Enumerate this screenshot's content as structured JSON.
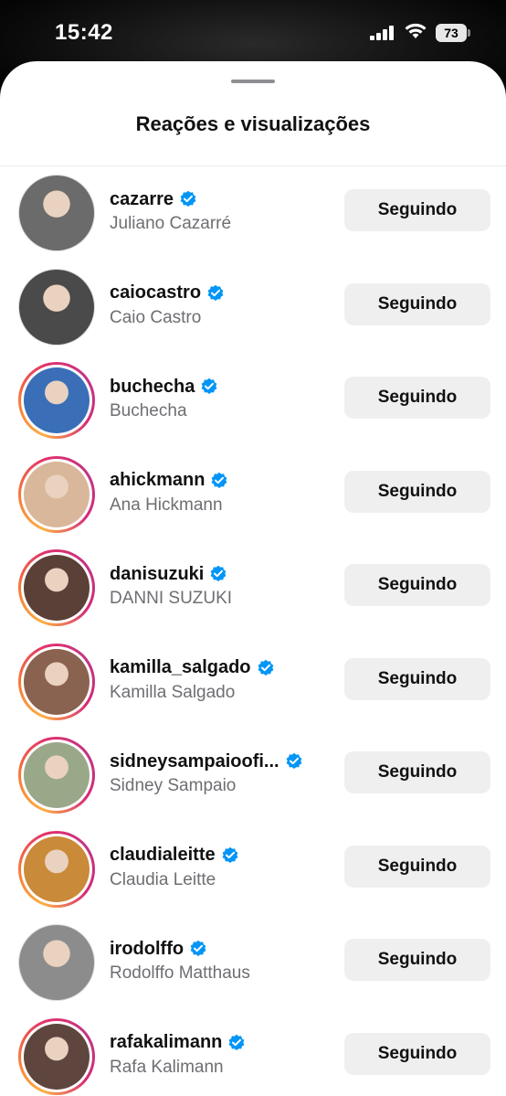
{
  "status_bar": {
    "time": "15:42",
    "battery": "73"
  },
  "sheet": {
    "title": "Reações e visualizações"
  },
  "accounts": [
    {
      "username": "cazarre",
      "full_name": "Juliano Cazarré",
      "button": "Seguindo",
      "story_ring": false,
      "avatar_color": "#6b6b6b"
    },
    {
      "username": "caiocastro",
      "full_name": "Caio Castro",
      "button": "Seguindo",
      "story_ring": false,
      "avatar_color": "#4a4a4a"
    },
    {
      "username": "buchecha",
      "full_name": "Buchecha",
      "button": "Seguindo",
      "story_ring": true,
      "avatar_color": "#3a6fb8"
    },
    {
      "username": "ahickmann",
      "full_name": "Ana Hickmann",
      "button": "Seguindo",
      "story_ring": true,
      "avatar_color": "#d9b79a"
    },
    {
      "username": "danisuzuki",
      "full_name": "DANNI SUZUKI",
      "button": "Seguindo",
      "story_ring": true,
      "avatar_color": "#5a4036"
    },
    {
      "username": "kamilla_salgado",
      "full_name": "Kamilla Salgado",
      "button": "Seguindo",
      "story_ring": true,
      "avatar_color": "#8a6250"
    },
    {
      "username": "sidneysampaioofi...",
      "full_name": "Sidney Sampaio",
      "button": "Seguindo",
      "story_ring": true,
      "avatar_color": "#9aa88a"
    },
    {
      "username": "claudialeitte",
      "full_name": "Claudia Leitte",
      "button": "Seguindo",
      "story_ring": true,
      "avatar_color": "#c98a3a"
    },
    {
      "username": "irodolffo",
      "full_name": "Rodolffo Matthaus",
      "button": "Seguindo",
      "story_ring": false,
      "avatar_color": "#8c8c8c"
    },
    {
      "username": "rafakalimann",
      "full_name": "Rafa Kalimann",
      "button": "Seguindo",
      "story_ring": true,
      "avatar_color": "#5e463e"
    }
  ],
  "colors": {
    "verified_badge": "#0095f6",
    "button_bg": "#efefef"
  }
}
